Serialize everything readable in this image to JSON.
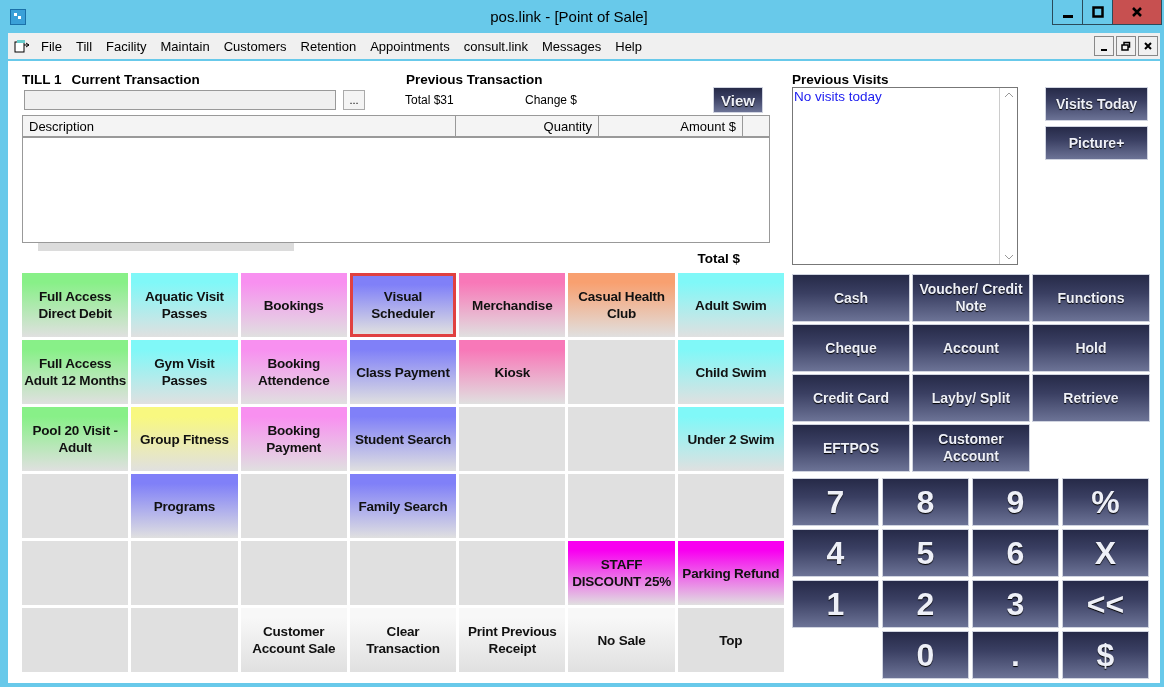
{
  "window": {
    "title": "pos.link - [Point of Sale]"
  },
  "menu": [
    "File",
    "Till",
    "Facility",
    "Maintain",
    "Customers",
    "Retention",
    "Appointments",
    "consult.link",
    "Messages",
    "Help"
  ],
  "transaction": {
    "till": "TILL 1",
    "heading": "Current Transaction",
    "more_button": "...",
    "columns": [
      "Description",
      "Quantity",
      "Amount $"
    ],
    "total_label": "Total $"
  },
  "previous_transaction": {
    "heading": "Previous Transaction",
    "total": "Total $31",
    "change": "Change $",
    "view_button": "View"
  },
  "previous_visits": {
    "heading": "Previous Visits",
    "items": [
      "No visits today"
    ],
    "buttons": [
      "Visits Today",
      "Picture+"
    ]
  },
  "tiles": [
    {
      "label": "Full Access Direct Debit",
      "color": "#88f088",
      "selected": false
    },
    {
      "label": "Aquatic Visit Passes",
      "color": "#80f8f8",
      "selected": false
    },
    {
      "label": "Bookings",
      "color": "#f890f0",
      "selected": false
    },
    {
      "label": "Visual Scheduler",
      "color": "#8080f8",
      "selected": true
    },
    {
      "label": "Merchandise",
      "color": "#f878b8",
      "selected": false
    },
    {
      "label": "Casual Health Club",
      "color": "#f8a070",
      "selected": false
    },
    {
      "label": "Adult Swim",
      "color": "#80f8f8",
      "selected": false
    },
    {
      "label": "Full Access Adult 12 Months",
      "color": "#88f088",
      "selected": false
    },
    {
      "label": "Gym Visit Passes",
      "color": "#80f8f8",
      "selected": false
    },
    {
      "label": "Booking Attendence",
      "color": "#f890f0",
      "selected": false
    },
    {
      "label": "Class Payment",
      "color": "#8080f8",
      "selected": false
    },
    {
      "label": "Kiosk",
      "color": "#f878b8",
      "selected": false
    },
    {
      "color": "#e0e0e0",
      "selected": false
    },
    {
      "label": "Child Swim",
      "color": "#80f8f8",
      "selected": false
    },
    {
      "label": "Pool 20 Visit - Adult",
      "color": "#88f088",
      "selected": false
    },
    {
      "label": "Group Fitness",
      "color": "#f8f880",
      "selected": false
    },
    {
      "label": "Booking Payment",
      "color": "#f890f0",
      "selected": false
    },
    {
      "label": "Student Search",
      "color": "#8080f8",
      "selected": false
    },
    {
      "color": "#e0e0e0",
      "selected": false
    },
    {
      "color": "#e0e0e0",
      "selected": false
    },
    {
      "label": "Under 2 Swim",
      "color": "#80f8f8",
      "selected": false
    },
    {
      "color": "#e0e0e0",
      "selected": false
    },
    {
      "label": "Programs",
      "color": "#8080f8",
      "selected": false
    },
    {
      "color": "#e0e0e0",
      "selected": false
    },
    {
      "label": "Family Search",
      "color": "#8080f8",
      "selected": false
    },
    {
      "color": "#e0e0e0",
      "selected": false
    },
    {
      "color": "#e0e0e0",
      "selected": false
    },
    {
      "color": "#e0e0e0",
      "selected": false
    },
    {
      "color": "#e0e0e0",
      "selected": false
    },
    {
      "color": "#e0e0e0",
      "selected": false
    },
    {
      "color": "#e0e0e0",
      "selected": false
    },
    {
      "color": "#e0e0e0",
      "selected": false
    },
    {
      "color": "#e0e0e0",
      "selected": false
    },
    {
      "label": "STAFF DISCOUNT 25%",
      "color": "#f800f0",
      "selected": false
    },
    {
      "label": "Parking Refund",
      "color": "#f800f0",
      "selected": false
    },
    {
      "color": "#e0e0e0",
      "selected": false
    },
    {
      "color": "#e0e0e0",
      "selected": false
    },
    {
      "label": "Customer Account Sale",
      "color": "#f8f8f8",
      "selected": false
    },
    {
      "label": "Clear Transaction",
      "color": "#f8f8f8",
      "selected": false
    },
    {
      "label": "Print Previous Receipt",
      "color": "#f8f8f8",
      "selected": false
    },
    {
      "label": "No Sale",
      "color": "#f8f8f8",
      "selected": false
    },
    {
      "label": "Top",
      "color": "#e0e0e0",
      "selected": false
    }
  ],
  "payment_buttons": [
    "Cash",
    "Voucher/ Credit Note",
    "Functions",
    "Cheque",
    "Account",
    "Hold",
    "Credit Card",
    "Layby/ Split",
    "Retrieve",
    "EFTPOS",
    "Customer Account"
  ],
  "keypad": [
    "7",
    "8",
    "9",
    "%",
    "4",
    "5",
    "6",
    "X",
    "1",
    "2",
    "3",
    "<<",
    "0",
    ".",
    "$"
  ]
}
